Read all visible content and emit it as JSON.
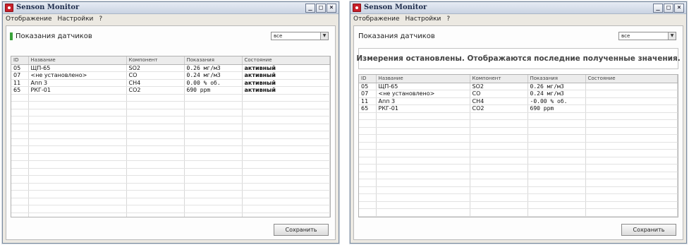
{
  "app": {
    "title": "Senson Monitor",
    "min": "_",
    "max": "□",
    "close": "×"
  },
  "menu": [
    "Отображение",
    "Настройки",
    "?"
  ],
  "section_title": "Показания датчиков",
  "filter": {
    "value": "все",
    "arrow": "▼"
  },
  "columns": [
    "ID",
    "Название",
    "Компонент",
    "Показания",
    "Состояние"
  ],
  "save_label": "Сохранить",
  "left_panel": {
    "rows": [
      {
        "id": "05",
        "name": "ЩП-65",
        "component": "SO2",
        "reading": "0.26  мг/м3",
        "status": "активный",
        "muted": false
      },
      {
        "id": "07",
        "name": "<не установлено>",
        "component": "CO",
        "reading": "0.24  мг/м3",
        "status": "активный",
        "muted": true
      },
      {
        "id": "11",
        "name": "Апп 3",
        "component": "CH4",
        "reading": "0.00  % об.",
        "status": "активный",
        "muted": false
      },
      {
        "id": "65",
        "name": "РКГ-01",
        "component": "CO2",
        "reading": "690  ppm",
        "status": "активный",
        "muted": false
      }
    ]
  },
  "right_panel": {
    "notice": "Измерения остановлены. Отображаются последние полученные значения.",
    "rows": [
      {
        "id": "05",
        "name": "ЩП-65",
        "component": "SO2",
        "reading": "0.26  мг/м3",
        "status": "",
        "muted": false
      },
      {
        "id": "07",
        "name": "<не установлено>",
        "component": "CO",
        "reading": "0.24  мг/м3",
        "status": "",
        "muted": true
      },
      {
        "id": "11",
        "name": "Апп 3",
        "component": "CH4",
        "reading": "-0.00  % об.",
        "status": "",
        "muted": false
      },
      {
        "id": "65",
        "name": "РКГ-01",
        "component": "CO2",
        "reading": "690  ppm",
        "status": "",
        "muted": false
      }
    ]
  },
  "colors": {
    "active_marker": "#3aa33a",
    "app_icon": "#c8202a"
  }
}
